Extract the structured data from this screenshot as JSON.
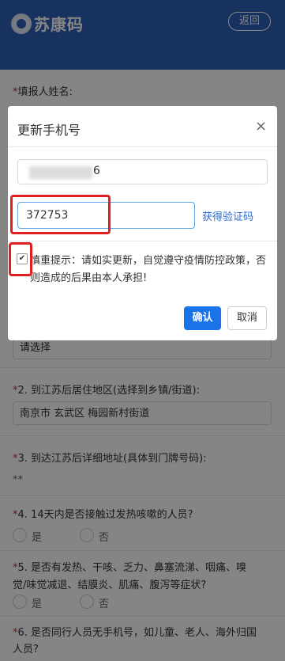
{
  "header": {
    "title": "苏康码",
    "back_label": "返回"
  },
  "form": {
    "q0_label": "填报人姓名:",
    "select_placeholder": "请选择",
    "q2": {
      "num": "2.",
      "label": "到江苏后居住地区(选择到乡镇/街道):",
      "value": "南京市 玄武区 梅园新村街道"
    },
    "q3": {
      "num": "3.",
      "label": "到达江苏后详细地址(具体到门牌号码):",
      "value": "**"
    },
    "q4": {
      "num": "4.",
      "label": "14天内是否接触过发热咳嗽的人员?",
      "yes": "是",
      "no": "否"
    },
    "q5": {
      "num": "5.",
      "label_line1": "是否有发热、干咳、乏力、鼻塞流涕、咽痛、嗅",
      "label_line2": "觉/味觉减退、结膜炎、肌痛、腹泻等症状?",
      "yes": "是",
      "no": "否"
    },
    "q6": {
      "num": "6.",
      "label_line1": "是否同行人员无手机号，如儿童、老人、海外归国",
      "label_line2": "人员?"
    }
  },
  "modal": {
    "title": "更新手机号",
    "close": "×",
    "phone_tail": "6",
    "code_value": "372753",
    "get_code_label": "获得验证码",
    "checkbox_mark": "✔",
    "hint_text": "慎重提示：请如实更新，自觉遵守疫情防控政策，否则造成的后果由本人承担!",
    "confirm_label": "确认",
    "cancel_label": "取消"
  },
  "colors": {
    "header_bg": "#2f61b8",
    "accent": "#1a73e8",
    "highlight": "#e02020"
  }
}
